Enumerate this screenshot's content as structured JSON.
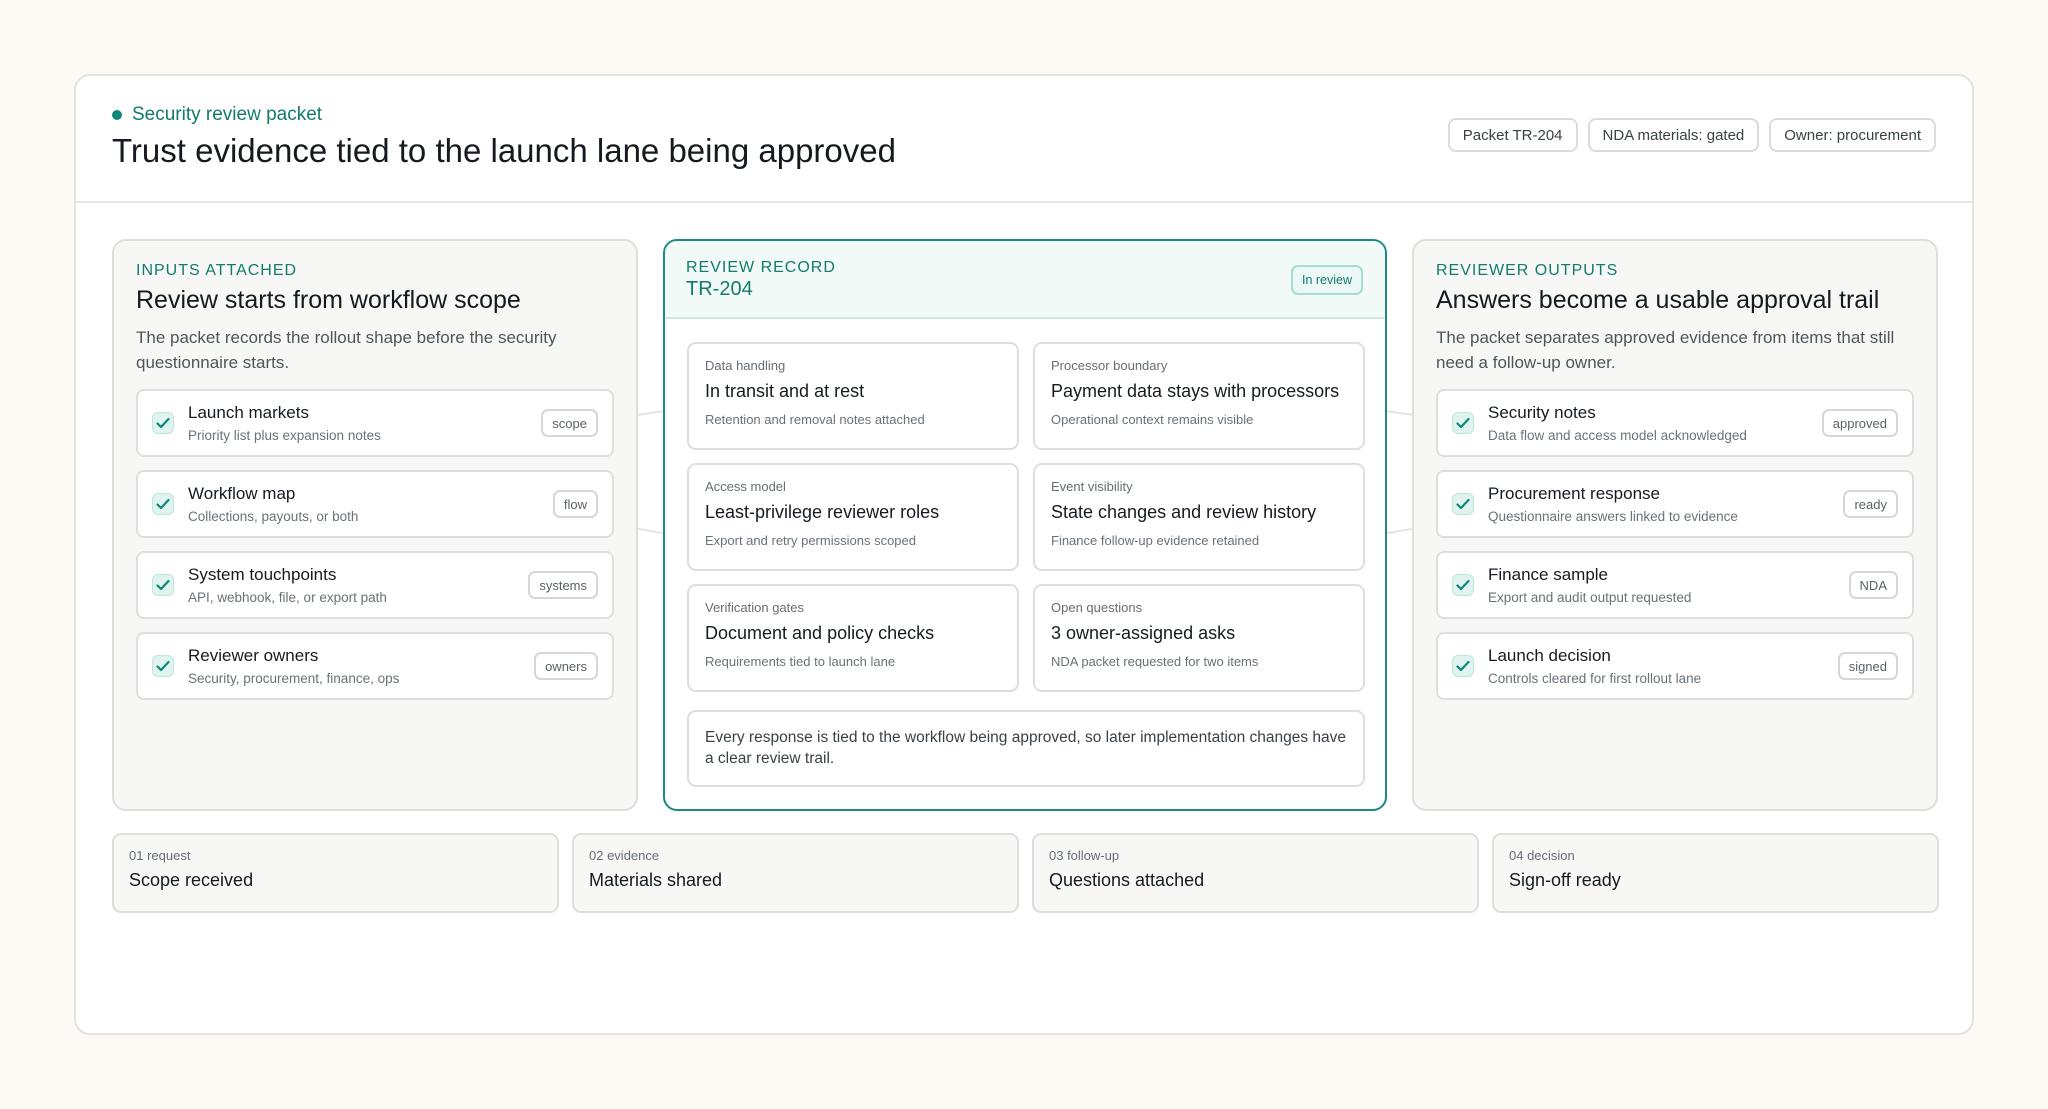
{
  "header": {
    "eyebrow": "Security review packet",
    "title": "Trust evidence tied to the launch lane being approved",
    "chips": [
      "Packet TR-204",
      "NDA materials: gated",
      "Owner: procurement"
    ]
  },
  "inputs": {
    "kicker": "INPUTS ATTACHED",
    "title": "Review starts from workflow scope",
    "lead": "The packet records the rollout shape before the security questionnaire starts.",
    "items": [
      {
        "title": "Launch markets",
        "sub": "Priority list plus expansion notes",
        "tag": "scope"
      },
      {
        "title": "Workflow map",
        "sub": "Collections, payouts, or both",
        "tag": "flow"
      },
      {
        "title": "System touchpoints",
        "sub": "API, webhook, file, or export path",
        "tag": "systems"
      },
      {
        "title": "Reviewer owners",
        "sub": "Security, procurement, finance, ops",
        "tag": "owners"
      }
    ]
  },
  "record": {
    "kicker": "REVIEW RECORD",
    "id": "TR-204",
    "status": "In review",
    "cards": [
      {
        "label": "Data handling",
        "title": "In transit and at rest",
        "sub": "Retention and removal notes attached"
      },
      {
        "label": "Processor boundary",
        "title": "Payment data stays with processors",
        "sub": "Operational context remains visible"
      },
      {
        "label": "Access model",
        "title": "Least-privilege reviewer roles",
        "sub": "Export and retry permissions scoped"
      },
      {
        "label": "Event visibility",
        "title": "State changes and review history",
        "sub": "Finance follow-up evidence retained"
      },
      {
        "label": "Verification gates",
        "title": "Document and policy checks",
        "sub": "Requirements tied to launch lane"
      },
      {
        "label": "Open questions",
        "title": "3 owner-assigned asks",
        "sub": "NDA packet requested for two items"
      }
    ],
    "note": "Every response is tied to the workflow being approved, so later implementation changes have a clear review trail."
  },
  "outputs": {
    "kicker": "REVIEWER OUTPUTS",
    "title": "Answers become a usable approval trail",
    "lead": "The packet separates approved evidence from items that still need a follow-up owner.",
    "items": [
      {
        "title": "Security notes",
        "sub": "Data flow and access model acknowledged",
        "tag": "approved"
      },
      {
        "title": "Procurement response",
        "sub": "Questionnaire answers linked to evidence",
        "tag": "ready"
      },
      {
        "title": "Finance sample",
        "sub": "Export and audit output requested",
        "tag": "NDA"
      },
      {
        "title": "Launch decision",
        "sub": "Controls cleared for first rollout lane",
        "tag": "signed"
      }
    ]
  },
  "steps": [
    {
      "num": "01 request",
      "title": "Scope received"
    },
    {
      "num": "02 evidence",
      "title": "Materials shared"
    },
    {
      "num": "03 follow-up",
      "title": "Questions attached"
    },
    {
      "num": "04 decision",
      "title": "Sign-off ready"
    }
  ],
  "colors": {
    "accent": "#127b6c",
    "background": "#fdf9f4",
    "panel": "#f7f7f6"
  },
  "icons": {
    "check": "check-icon",
    "status_dot": "status-dot-icon"
  }
}
